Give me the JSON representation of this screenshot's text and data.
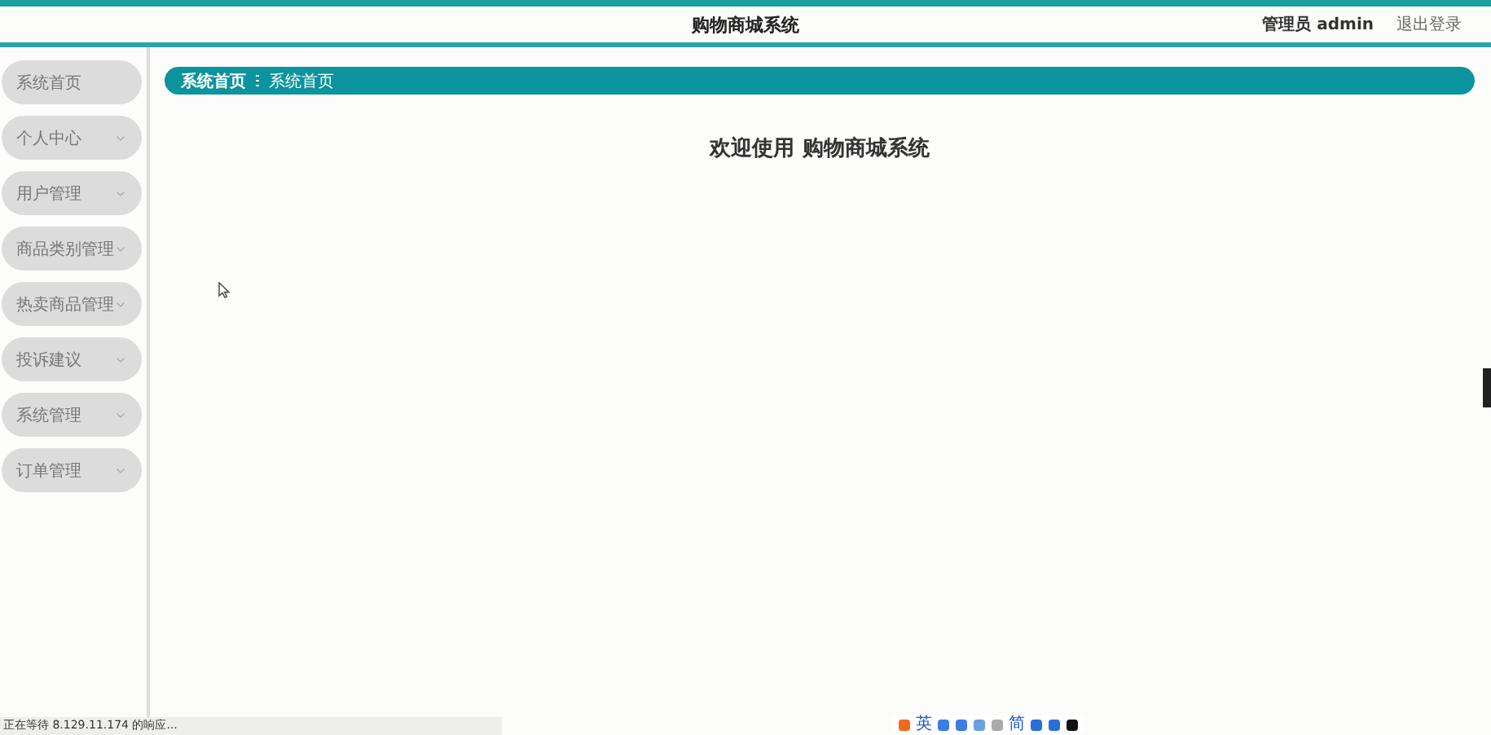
{
  "header": {
    "title": "购物商城系统",
    "user": "管理员 admin",
    "logout": "退出登录"
  },
  "sidebar": {
    "items": [
      {
        "label": "系统首页",
        "expandable": false
      },
      {
        "label": "个人中心",
        "expandable": true
      },
      {
        "label": "用户管理",
        "expandable": true
      },
      {
        "label": "商品类别管理",
        "expandable": true
      },
      {
        "label": "热卖商品管理",
        "expandable": true
      },
      {
        "label": "投诉建议",
        "expandable": true
      },
      {
        "label": "系统管理",
        "expandable": true
      },
      {
        "label": "订单管理",
        "expandable": true
      }
    ]
  },
  "breadcrumb": {
    "items": [
      "系统首页",
      "系统首页"
    ]
  },
  "welcome": "欢迎使用 购物商城系统",
  "status_bar": "正在等待 8.129.11.174 的响应...",
  "ime_bar": {
    "texts": [
      "英",
      "简"
    ]
  }
}
